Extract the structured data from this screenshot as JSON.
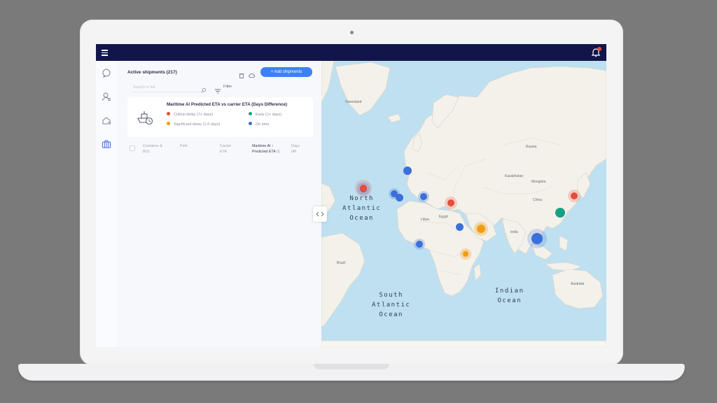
{
  "header": {
    "menu_icon": "hamburger-menu-icon",
    "notification_icon": "bell-icon"
  },
  "sidebar": {
    "items": [
      {
        "icon": "chat-icon"
      },
      {
        "icon": "user-search-icon"
      },
      {
        "icon": "shipment-settings-icon"
      },
      {
        "icon": "container-icon"
      }
    ]
  },
  "panel": {
    "title": "Active shipments (217)",
    "add_button_label": "+ Add shipments",
    "search_placeholder": "Search in list",
    "filter_label": "Filter",
    "legend": {
      "title": "Maritime AI Predicted ETA vs carrier ETA (Days Difference)",
      "items": [
        {
          "label": "Critical delay (7+ days)",
          "color": "#e74c3c"
        },
        {
          "label": "Early (1+ days)",
          "color": "#16a085"
        },
        {
          "label": "Significant delay (1-6 days)",
          "color": "#f39c12"
        },
        {
          "label": "On time",
          "color": "#3b6fd9"
        }
      ]
    },
    "table_headers": {
      "col1a": "Container &",
      "col1b": "BOL",
      "col2": "Path",
      "col3a": "Carrier",
      "col3b": "ETA",
      "col4a": "Maritime AI ↑",
      "col4b": "Predicted ETA ⓘ",
      "col5a": "Days",
      "col5b": "diff"
    }
  },
  "map": {
    "labels": {
      "north_atlantic": [
        "North",
        "Atlantic",
        "Ocean"
      ],
      "south_atlantic": [
        "South",
        "Atlantic",
        "Ocean"
      ],
      "indian": [
        "Indian",
        "Ocean"
      ]
    },
    "countries": [
      "Greenland",
      "Russia",
      "China",
      "India",
      "Egypt",
      "Libya",
      "Brazil",
      "Australia",
      "Kazakhstan",
      "Mongolia"
    ],
    "marker_colors": {
      "red": "#e74c3c",
      "blue": "#3b6fd9",
      "orange": "#f39c12",
      "teal": "#16a085"
    }
  }
}
